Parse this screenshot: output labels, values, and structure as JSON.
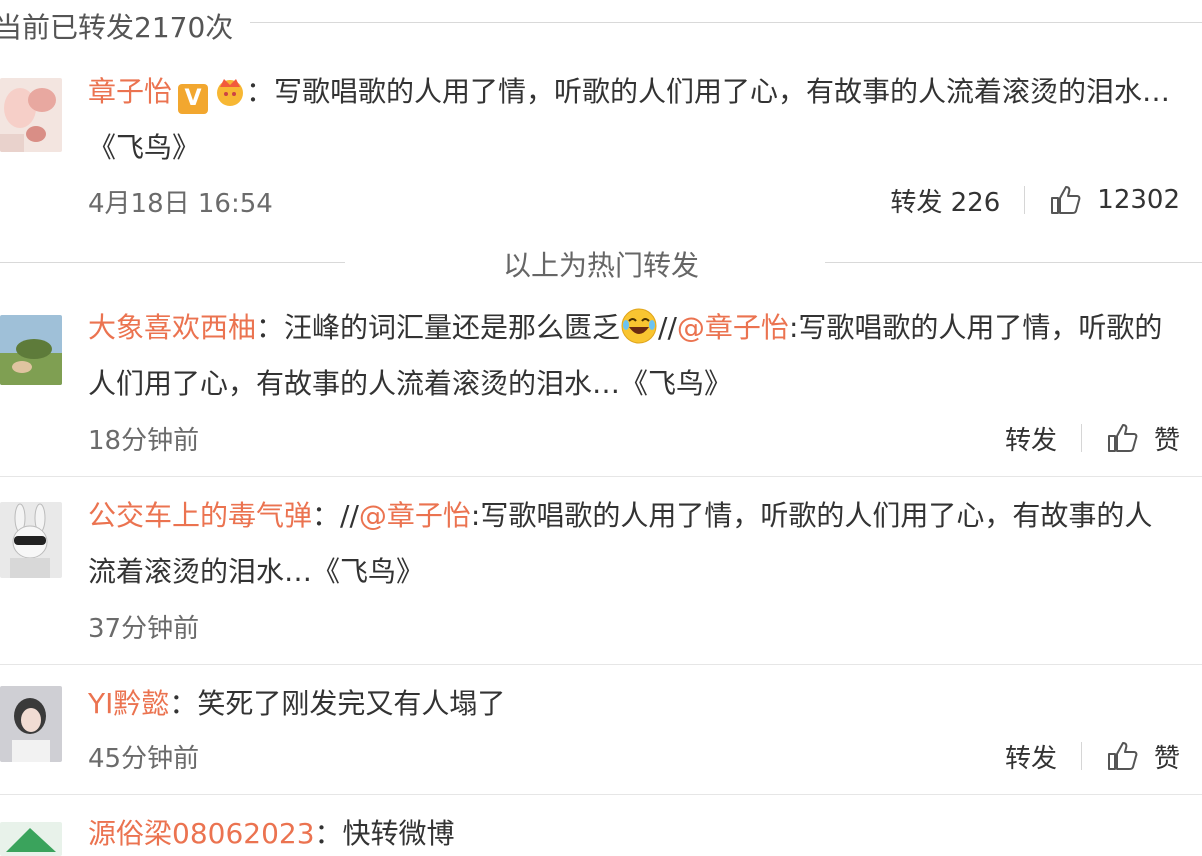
{
  "header": {
    "repost_count_text": "当前已转发2170次"
  },
  "hot_label": "以上为热门转发",
  "posts": [
    {
      "username": "章子怡",
      "sep": "：",
      "text": "写歌唱歌的人用了情，听歌的人们用了心，有故事的人流着滚烫的泪水…《飞鸟》",
      "time": "4月18日 16:54",
      "repost_label": "转发",
      "repost_count": "226",
      "like_count": "12302"
    },
    {
      "username": "大象喜欢西柚",
      "sep": "：",
      "text_before": "汪峰的词汇量还是那么匮乏",
      "slash": "//",
      "mention": "@章子怡",
      "text_after": ":写歌唱歌的人用了情，听歌的人们用了心，有故事的人流着滚烫的泪水…《飞鸟》",
      "time": "18分钟前",
      "repost_label": "转发",
      "like_label": "赞"
    },
    {
      "username": "公交车上的毒气弹",
      "sep": "：",
      "slash": "//",
      "mention": "@章子怡",
      "text_after": ":写歌唱歌的人用了情，听歌的人们用了心，有故事的人流着滚烫的泪水…《飞鸟》",
      "time": "37分钟前"
    },
    {
      "username": "YI黔懿",
      "sep": "：",
      "text": "笑死了刚发完又有人塌了",
      "time": "45分钟前",
      "repost_label": "转发",
      "like_label": "赞"
    },
    {
      "username": "源俗梁08062023",
      "sep": "：",
      "text": "快转微博"
    }
  ],
  "colors": {
    "username": "#eb7350",
    "text": "#333333",
    "meta": "#6b6b6b"
  },
  "icons": {
    "like": "thumbs-up-icon",
    "verified": "verified-v-badge",
    "vip": "crown-badge",
    "laugh": "laughing-emoji"
  }
}
